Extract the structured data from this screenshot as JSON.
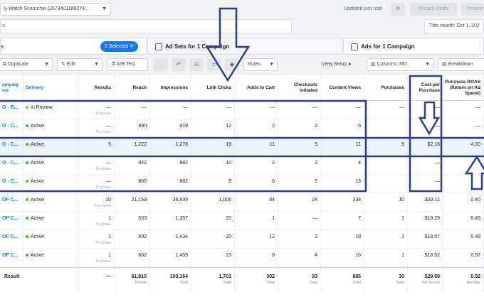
{
  "topbar": {
    "account": "ly Watch Scrunchie (2673401186274...",
    "updated": "Updated just now",
    "discard": "Discard Drafts",
    "review": "Review"
  },
  "search": {
    "value": "o"
  },
  "date_range": "This month: Oct 1, 202",
  "tabs": {
    "campaigns_label": "s",
    "selected_pill": "1 Selected",
    "adsets": "Ad Sets for 1 Campaign",
    "ads": "Ads for 1 Campaign"
  },
  "toolbar": {
    "duplicate": "Duplicate",
    "edit": "Edit",
    "abtest": "A/B Test",
    "rules": "Rules",
    "view_setup": "View Setup",
    "columns": "Columns: MD",
    "breakdown": "Breakdown"
  },
  "columns": [
    {
      "key": "name",
      "label": "ampaig me"
    },
    {
      "key": "delivery",
      "label": "Delivery"
    },
    {
      "key": "results",
      "label": "Results"
    },
    {
      "key": "reach",
      "label": "Reach"
    },
    {
      "key": "impressions",
      "label": "Impressions"
    },
    {
      "key": "link_clicks",
      "label": "Link Clicks"
    },
    {
      "key": "adds_to_cart",
      "label": "Adds to Cart"
    },
    {
      "key": "checkouts",
      "label": "Checkouts Initiated"
    },
    {
      "key": "content_views",
      "label": "Content Views"
    },
    {
      "key": "purchases",
      "label": "Purchases"
    },
    {
      "key": "cost_per_purchase",
      "label": "Cost per Purchase"
    },
    {
      "key": "roas",
      "label": "Purchase ROAS (Return on Ad Spend)"
    }
  ],
  "rows": [
    {
      "name": "O - R...",
      "delivery": "In Review",
      "status": "review",
      "results": "—",
      "results_sub": "Purchase",
      "reach": "—",
      "impressions": "—",
      "link_clicks": "—",
      "adds_to_cart": "—",
      "checkouts": "—",
      "content_views": "—",
      "purchases": "—",
      "cost_per_purchase": "—",
      "roas": "—"
    },
    {
      "name": "O - C...",
      "delivery": "Active",
      "status": "active",
      "results": "—",
      "results_sub": "Purchase",
      "reach": "890",
      "impressions": "919",
      "link_clicks": "12",
      "adds_to_cart": "2",
      "checkouts": "2",
      "content_views": "6",
      "purchases": "",
      "cost_per_purchase": "—",
      "roas": "—"
    },
    {
      "name": "O - C...",
      "delivery": "Active",
      "status": "active",
      "results": "5",
      "results_sub": "",
      "reach": "1,222",
      "impressions": "1,278",
      "link_clicks": "19",
      "adds_to_cart": "11",
      "checkouts": "5",
      "content_views": "11",
      "purchases": "5",
      "cost_per_purchase": "$2.16",
      "roas": "4.00"
    },
    {
      "name": "O - C...",
      "delivery": "Active",
      "status": "active",
      "results": "—",
      "results_sub": "Purchase",
      "reach": "842",
      "impressions": "882",
      "link_clicks": "10",
      "adds_to_cart": "2",
      "checkouts": "2",
      "content_views": "4",
      "purchases": "",
      "cost_per_purchase": "—",
      "roas": ""
    },
    {
      "name": "O - C...",
      "delivery": "Active",
      "status": "active",
      "results": "—",
      "results_sub": "Purchase",
      "reach": "860",
      "impressions": "882",
      "link_clicks": "9",
      "adds_to_cart": "6",
      "checkouts": "5",
      "content_views": "13",
      "purchases": "",
      "cost_per_purchase": "—",
      "roas": ""
    },
    {
      "name": "OF C...",
      "delivery": "Active",
      "status": "active",
      "results": "10",
      "results_sub": "Purchases",
      "reach": "21,159",
      "impressions": "36,839",
      "link_clicks": "1,006",
      "adds_to_cart": "84",
      "checkouts": "24",
      "content_views": "338",
      "purchases": "10",
      "cost_per_purchase": "$33.11",
      "roas": "0.40"
    },
    {
      "name": "OF C...",
      "delivery": "Active",
      "status": "active",
      "results": "1",
      "results_sub": "Purchase",
      "reach": "533",
      "impressions": "1,357",
      "link_clicks": "20",
      "adds_to_cart": "1",
      "checkouts": "—",
      "content_views": "7",
      "purchases": "1",
      "cost_per_purchase": "$18.29",
      "roas": "0.49"
    },
    {
      "name": "OF C...",
      "delivery": "Active",
      "status": "active",
      "results": "1",
      "results_sub": "Purchase",
      "reach": "602",
      "impressions": "1,434",
      "link_clicks": "20",
      "adds_to_cart": "12",
      "checkouts": "2",
      "content_views": "18",
      "purchases": "1",
      "cost_per_purchase": "$18.57",
      "roas": "0.48"
    },
    {
      "name": "OF C...",
      "delivery": "Active",
      "status": "active",
      "results": "1",
      "results_sub": "Purchase",
      "reach": "662",
      "impressions": "1,459",
      "link_clicks": "23",
      "adds_to_cart": "8",
      "checkouts": "4",
      "content_views": "16",
      "purchases": "1",
      "cost_per_purchase": "$18.52",
      "roas": "0.97"
    }
  ],
  "result_row": {
    "label": "Result",
    "results": "—",
    "reach": "61,815",
    "reach_sub": "People",
    "impressions": "103,164",
    "impressions_sub": "Total",
    "link_clicks": "1,701",
    "link_clicks_sub": "Total",
    "adds_to_cart": "302",
    "adds_to_cart_sub": "Total",
    "checkouts": "93",
    "checkouts_sub": "Total",
    "content_views": "885",
    "content_views_sub": "Total",
    "purchases": "30",
    "purchases_sub": "Total",
    "cost_per_purchase": "$29.68",
    "cost_per_purchase_sub": "Per Action",
    "roas": "0.52",
    "roas_sub": "Average"
  },
  "colors": {
    "accent": "#1877f2",
    "active": "#42b72a",
    "review": "#8bc34a",
    "annotation": "#2e3d8f"
  },
  "icons": [
    "chevron-down-icon",
    "refresh-icon",
    "duplicate-icon",
    "pencil-icon",
    "flask-icon",
    "trash-icon",
    "undo-icon",
    "lock-icon",
    "tag-icon",
    "columns-icon",
    "breakdown-icon"
  ]
}
